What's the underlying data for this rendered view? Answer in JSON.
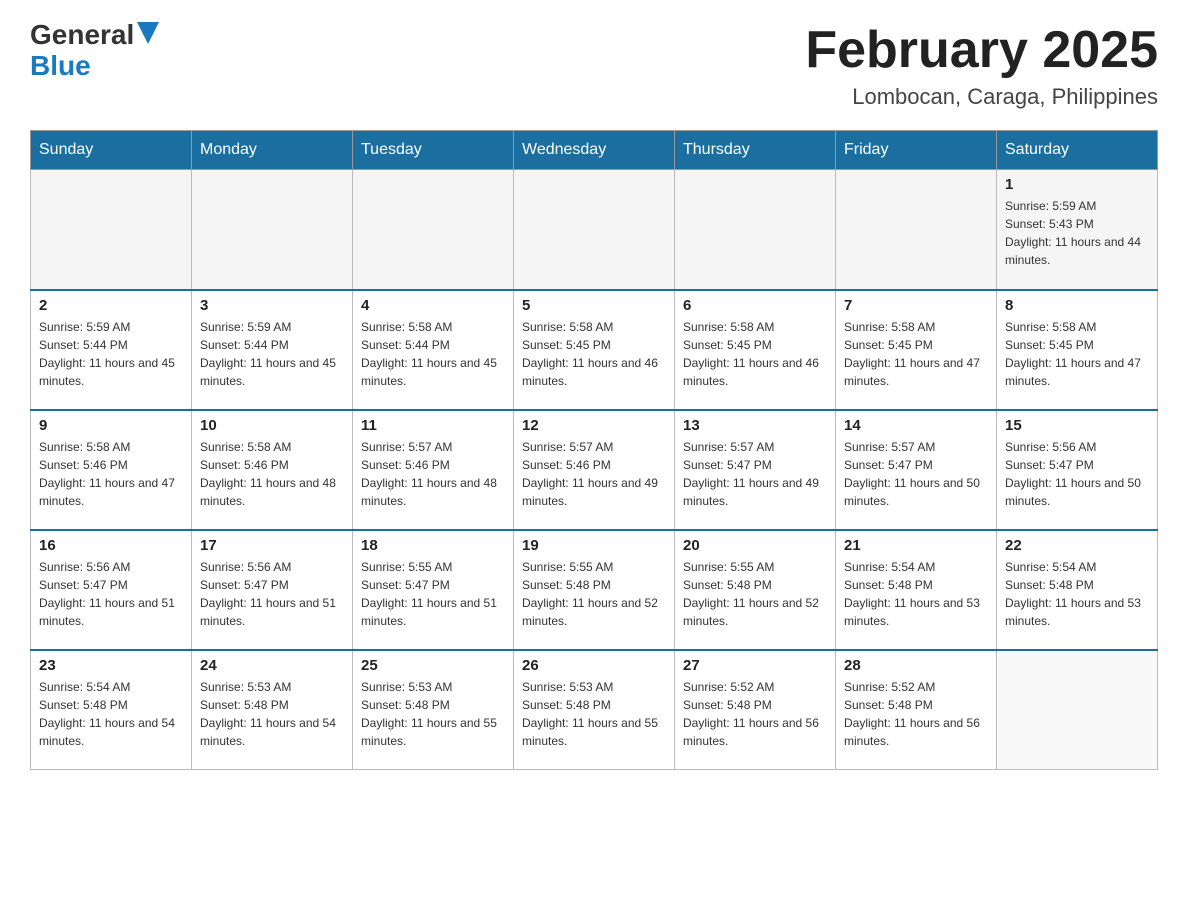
{
  "header": {
    "logo_general": "General",
    "logo_blue": "Blue",
    "month_title": "February 2025",
    "location": "Lombocan, Caraga, Philippines"
  },
  "weekdays": [
    "Sunday",
    "Monday",
    "Tuesday",
    "Wednesday",
    "Thursday",
    "Friday",
    "Saturday"
  ],
  "weeks": [
    [
      {
        "day": "",
        "sunrise": "",
        "sunset": "",
        "daylight": ""
      },
      {
        "day": "",
        "sunrise": "",
        "sunset": "",
        "daylight": ""
      },
      {
        "day": "",
        "sunrise": "",
        "sunset": "",
        "daylight": ""
      },
      {
        "day": "",
        "sunrise": "",
        "sunset": "",
        "daylight": ""
      },
      {
        "day": "",
        "sunrise": "",
        "sunset": "",
        "daylight": ""
      },
      {
        "day": "",
        "sunrise": "",
        "sunset": "",
        "daylight": ""
      },
      {
        "day": "1",
        "sunrise": "Sunrise: 5:59 AM",
        "sunset": "Sunset: 5:43 PM",
        "daylight": "Daylight: 11 hours and 44 minutes."
      }
    ],
    [
      {
        "day": "2",
        "sunrise": "Sunrise: 5:59 AM",
        "sunset": "Sunset: 5:44 PM",
        "daylight": "Daylight: 11 hours and 45 minutes."
      },
      {
        "day": "3",
        "sunrise": "Sunrise: 5:59 AM",
        "sunset": "Sunset: 5:44 PM",
        "daylight": "Daylight: 11 hours and 45 minutes."
      },
      {
        "day": "4",
        "sunrise": "Sunrise: 5:58 AM",
        "sunset": "Sunset: 5:44 PM",
        "daylight": "Daylight: 11 hours and 45 minutes."
      },
      {
        "day": "5",
        "sunrise": "Sunrise: 5:58 AM",
        "sunset": "Sunset: 5:45 PM",
        "daylight": "Daylight: 11 hours and 46 minutes."
      },
      {
        "day": "6",
        "sunrise": "Sunrise: 5:58 AM",
        "sunset": "Sunset: 5:45 PM",
        "daylight": "Daylight: 11 hours and 46 minutes."
      },
      {
        "day": "7",
        "sunrise": "Sunrise: 5:58 AM",
        "sunset": "Sunset: 5:45 PM",
        "daylight": "Daylight: 11 hours and 47 minutes."
      },
      {
        "day": "8",
        "sunrise": "Sunrise: 5:58 AM",
        "sunset": "Sunset: 5:45 PM",
        "daylight": "Daylight: 11 hours and 47 minutes."
      }
    ],
    [
      {
        "day": "9",
        "sunrise": "Sunrise: 5:58 AM",
        "sunset": "Sunset: 5:46 PM",
        "daylight": "Daylight: 11 hours and 47 minutes."
      },
      {
        "day": "10",
        "sunrise": "Sunrise: 5:58 AM",
        "sunset": "Sunset: 5:46 PM",
        "daylight": "Daylight: 11 hours and 48 minutes."
      },
      {
        "day": "11",
        "sunrise": "Sunrise: 5:57 AM",
        "sunset": "Sunset: 5:46 PM",
        "daylight": "Daylight: 11 hours and 48 minutes."
      },
      {
        "day": "12",
        "sunrise": "Sunrise: 5:57 AM",
        "sunset": "Sunset: 5:46 PM",
        "daylight": "Daylight: 11 hours and 49 minutes."
      },
      {
        "day": "13",
        "sunrise": "Sunrise: 5:57 AM",
        "sunset": "Sunset: 5:47 PM",
        "daylight": "Daylight: 11 hours and 49 minutes."
      },
      {
        "day": "14",
        "sunrise": "Sunrise: 5:57 AM",
        "sunset": "Sunset: 5:47 PM",
        "daylight": "Daylight: 11 hours and 50 minutes."
      },
      {
        "day": "15",
        "sunrise": "Sunrise: 5:56 AM",
        "sunset": "Sunset: 5:47 PM",
        "daylight": "Daylight: 11 hours and 50 minutes."
      }
    ],
    [
      {
        "day": "16",
        "sunrise": "Sunrise: 5:56 AM",
        "sunset": "Sunset: 5:47 PM",
        "daylight": "Daylight: 11 hours and 51 minutes."
      },
      {
        "day": "17",
        "sunrise": "Sunrise: 5:56 AM",
        "sunset": "Sunset: 5:47 PM",
        "daylight": "Daylight: 11 hours and 51 minutes."
      },
      {
        "day": "18",
        "sunrise": "Sunrise: 5:55 AM",
        "sunset": "Sunset: 5:47 PM",
        "daylight": "Daylight: 11 hours and 51 minutes."
      },
      {
        "day": "19",
        "sunrise": "Sunrise: 5:55 AM",
        "sunset": "Sunset: 5:48 PM",
        "daylight": "Daylight: 11 hours and 52 minutes."
      },
      {
        "day": "20",
        "sunrise": "Sunrise: 5:55 AM",
        "sunset": "Sunset: 5:48 PM",
        "daylight": "Daylight: 11 hours and 52 minutes."
      },
      {
        "day": "21",
        "sunrise": "Sunrise: 5:54 AM",
        "sunset": "Sunset: 5:48 PM",
        "daylight": "Daylight: 11 hours and 53 minutes."
      },
      {
        "day": "22",
        "sunrise": "Sunrise: 5:54 AM",
        "sunset": "Sunset: 5:48 PM",
        "daylight": "Daylight: 11 hours and 53 minutes."
      }
    ],
    [
      {
        "day": "23",
        "sunrise": "Sunrise: 5:54 AM",
        "sunset": "Sunset: 5:48 PM",
        "daylight": "Daylight: 11 hours and 54 minutes."
      },
      {
        "day": "24",
        "sunrise": "Sunrise: 5:53 AM",
        "sunset": "Sunset: 5:48 PM",
        "daylight": "Daylight: 11 hours and 54 minutes."
      },
      {
        "day": "25",
        "sunrise": "Sunrise: 5:53 AM",
        "sunset": "Sunset: 5:48 PM",
        "daylight": "Daylight: 11 hours and 55 minutes."
      },
      {
        "day": "26",
        "sunrise": "Sunrise: 5:53 AM",
        "sunset": "Sunset: 5:48 PM",
        "daylight": "Daylight: 11 hours and 55 minutes."
      },
      {
        "day": "27",
        "sunrise": "Sunrise: 5:52 AM",
        "sunset": "Sunset: 5:48 PM",
        "daylight": "Daylight: 11 hours and 56 minutes."
      },
      {
        "day": "28",
        "sunrise": "Sunrise: 5:52 AM",
        "sunset": "Sunset: 5:48 PM",
        "daylight": "Daylight: 11 hours and 56 minutes."
      },
      {
        "day": "",
        "sunrise": "",
        "sunset": "",
        "daylight": ""
      }
    ]
  ]
}
